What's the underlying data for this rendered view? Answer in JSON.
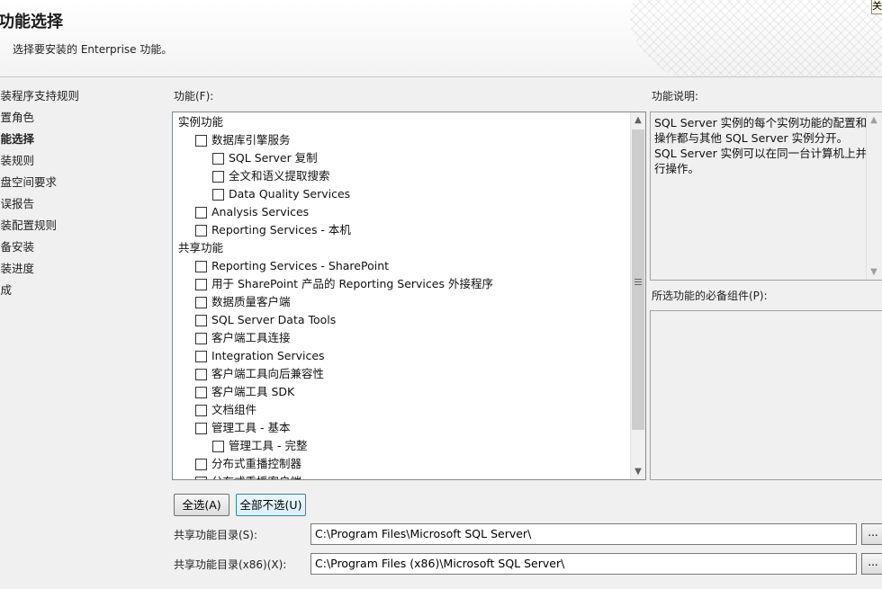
{
  "header": {
    "title": "功能选择",
    "subtitle": "选择要安装的 Enterprise 功能。",
    "corner_glyph": "关"
  },
  "sidebar": {
    "steps": [
      {
        "label": "安装程序支持规则",
        "active": false
      },
      {
        "label": "设置角色",
        "active": false
      },
      {
        "label": "功能选择",
        "active": true
      },
      {
        "label": "安装规则",
        "active": false
      },
      {
        "label": "磁盘空间要求",
        "active": false
      },
      {
        "label": "错误报告",
        "active": false
      },
      {
        "label": "安装配置规则",
        "active": false
      },
      {
        "label": "准备安装",
        "active": false
      },
      {
        "label": "安装进度",
        "active": false
      },
      {
        "label": "完成",
        "active": false
      }
    ]
  },
  "features": {
    "label": "功能(F):",
    "items": [
      {
        "label": "实例功能",
        "level": 0,
        "checkbox": false,
        "checked": false
      },
      {
        "label": "数据库引擎服务",
        "level": 1,
        "checkbox": true,
        "checked": false
      },
      {
        "label": "SQL Server 复制",
        "level": 2,
        "checkbox": true,
        "checked": false
      },
      {
        "label": "全文和语义提取搜索",
        "level": 2,
        "checkbox": true,
        "checked": false
      },
      {
        "label": "Data Quality Services",
        "level": 2,
        "checkbox": true,
        "checked": false
      },
      {
        "label": "Analysis Services",
        "level": 1,
        "checkbox": true,
        "checked": false
      },
      {
        "label": "Reporting Services - 本机",
        "level": 1,
        "checkbox": true,
        "checked": false
      },
      {
        "label": "共享功能",
        "level": 0,
        "checkbox": false,
        "checked": false
      },
      {
        "label": "Reporting Services - SharePoint",
        "level": 1,
        "checkbox": true,
        "checked": false
      },
      {
        "label": "用于 SharePoint 产品的 Reporting Services 外接程序",
        "level": 1,
        "checkbox": true,
        "checked": false
      },
      {
        "label": "数据质量客户端",
        "level": 1,
        "checkbox": true,
        "checked": false
      },
      {
        "label": "SQL Server Data Tools",
        "level": 1,
        "checkbox": true,
        "checked": false
      },
      {
        "label": "客户端工具连接",
        "level": 1,
        "checkbox": true,
        "checked": false
      },
      {
        "label": "Integration Services",
        "level": 1,
        "checkbox": true,
        "checked": false
      },
      {
        "label": "客户端工具向后兼容性",
        "level": 1,
        "checkbox": true,
        "checked": false
      },
      {
        "label": "客户端工具 SDK",
        "level": 1,
        "checkbox": true,
        "checked": false
      },
      {
        "label": "文档组件",
        "level": 1,
        "checkbox": true,
        "checked": false
      },
      {
        "label": "管理工具 - 基本",
        "level": 1,
        "checkbox": true,
        "checked": false
      },
      {
        "label": "管理工具 - 完整",
        "level": 2,
        "checkbox": true,
        "checked": false
      },
      {
        "label": "分布式重播控制器",
        "level": 1,
        "checkbox": true,
        "checked": false
      },
      {
        "label": "分布式重播客户端",
        "level": 1,
        "checkbox": true,
        "checked": false
      }
    ]
  },
  "description": {
    "label": "功能说明:",
    "text_1": "SQL Server 实例的每个实例功能的配置和操作都与其他 SQL Server 实例分开。",
    "text_2": "SQL Server 实例可以在同一台计算机上并行操作。"
  },
  "prerequisites": {
    "label": "所选功能的必备组件(P):"
  },
  "buttons": {
    "select_all": "全选(A)",
    "deselect_all": "全部不选(U)"
  },
  "shared_dir": {
    "label": "共享功能目录(S):",
    "value": "C:\\Program Files\\Microsoft SQL Server\\",
    "browse": "..."
  },
  "shared_dir_x86": {
    "label": "共享功能目录(x86)(X):",
    "value": "C:\\Program Files (x86)\\Microsoft SQL Server\\",
    "browse": "..."
  }
}
